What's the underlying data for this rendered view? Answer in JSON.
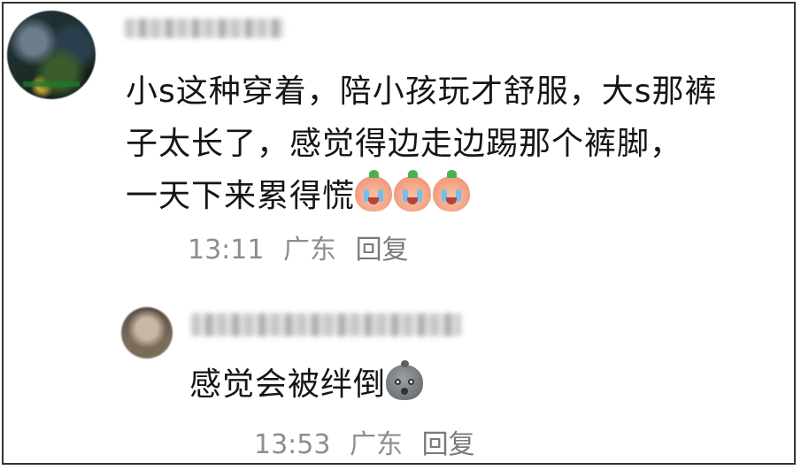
{
  "comment": {
    "text_lines": [
      "小s这种穿着，陪小孩玩才舒服，大s那裤",
      "子太长了，感觉得边走边踢那个裤脚，",
      "一天下来累得慌"
    ],
    "emoji": [
      "crying-face-icon",
      "crying-face-icon",
      "crying-face-icon"
    ],
    "time": "13:11",
    "location": "广东",
    "reply_label": "回复"
  },
  "reply": {
    "text": "感觉会被绊倒",
    "emoji": [
      "shocked-blob-icon"
    ],
    "time": "13:53",
    "location": "广东",
    "reply_label": "回复"
  }
}
